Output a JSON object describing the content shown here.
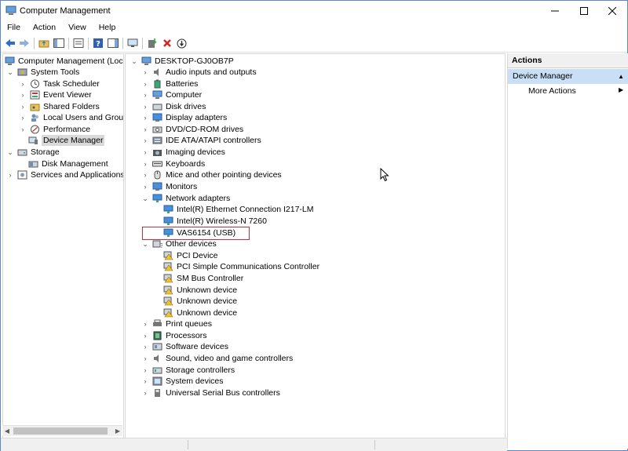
{
  "window": {
    "title": "Computer Management"
  },
  "menu": [
    "File",
    "Action",
    "View",
    "Help"
  ],
  "left_tree": [
    {
      "label": "Computer Management (Local",
      "indent": 0,
      "chev": "",
      "icon": "computer-management-icon"
    },
    {
      "label": "System Tools",
      "indent": 1,
      "chev": "down",
      "icon": "system-tools-icon"
    },
    {
      "label": "Task Scheduler",
      "indent": 2,
      "chev": "right",
      "icon": "task-scheduler-icon"
    },
    {
      "label": "Event Viewer",
      "indent": 2,
      "chev": "right",
      "icon": "event-viewer-icon"
    },
    {
      "label": "Shared Folders",
      "indent": 2,
      "chev": "right",
      "icon": "shared-folders-icon"
    },
    {
      "label": "Local Users and Groups",
      "indent": 2,
      "chev": "right",
      "icon": "users-icon"
    },
    {
      "label": "Performance",
      "indent": 2,
      "chev": "right",
      "icon": "performance-icon"
    },
    {
      "label": "Device Manager",
      "indent": 2,
      "chev": "",
      "icon": "device-manager-icon",
      "selected": true
    },
    {
      "label": "Storage",
      "indent": 1,
      "chev": "down",
      "icon": "storage-icon"
    },
    {
      "label": "Disk Management",
      "indent": 2,
      "chev": "",
      "icon": "disk-management-icon"
    },
    {
      "label": "Services and Applications",
      "indent": 1,
      "chev": "right",
      "icon": "services-icon"
    }
  ],
  "device_tree": {
    "root": "DESKTOP-GJ0OB7P",
    "categories": [
      {
        "label": "Audio inputs and outputs",
        "expanded": false,
        "icon": "audio-icon"
      },
      {
        "label": "Batteries",
        "expanded": false,
        "icon": "battery-icon"
      },
      {
        "label": "Computer",
        "expanded": false,
        "icon": "computer-icon"
      },
      {
        "label": "Disk drives",
        "expanded": false,
        "icon": "disk-drive-icon"
      },
      {
        "label": "Display adapters",
        "expanded": false,
        "icon": "display-icon"
      },
      {
        "label": "DVD/CD-ROM drives",
        "expanded": false,
        "icon": "dvd-icon"
      },
      {
        "label": "IDE ATA/ATAPI controllers",
        "expanded": false,
        "icon": "ide-icon"
      },
      {
        "label": "Imaging devices",
        "expanded": false,
        "icon": "camera-icon"
      },
      {
        "label": "Keyboards",
        "expanded": false,
        "icon": "keyboard-icon"
      },
      {
        "label": "Mice and other pointing devices",
        "expanded": false,
        "icon": "mouse-icon"
      },
      {
        "label": "Monitors",
        "expanded": false,
        "icon": "monitor-icon"
      },
      {
        "label": "Network adapters",
        "expanded": true,
        "icon": "network-icon",
        "children": [
          {
            "label": "Intel(R) Ethernet Connection I217-LM",
            "icon": "network-adapter-icon"
          },
          {
            "label": "Intel(R) Wireless-N 7260",
            "icon": "network-adapter-icon"
          },
          {
            "label": "VAS6154 (USB)",
            "icon": "network-adapter-icon",
            "highlighted": true
          }
        ]
      },
      {
        "label": "Other devices",
        "expanded": true,
        "icon": "other-devices-icon",
        "children": [
          {
            "label": "PCI Device",
            "icon": "warning-device-icon"
          },
          {
            "label": "PCI Simple Communications Controller",
            "icon": "warning-device-icon"
          },
          {
            "label": "SM Bus Controller",
            "icon": "warning-device-icon"
          },
          {
            "label": "Unknown device",
            "icon": "warning-device-icon"
          },
          {
            "label": "Unknown device",
            "icon": "warning-device-icon"
          },
          {
            "label": "Unknown device",
            "icon": "warning-device-icon"
          }
        ]
      },
      {
        "label": "Print queues",
        "expanded": false,
        "icon": "printer-icon"
      },
      {
        "label": "Processors",
        "expanded": false,
        "icon": "processor-icon"
      },
      {
        "label": "Software devices",
        "expanded": false,
        "icon": "software-icon"
      },
      {
        "label": "Sound, video and game controllers",
        "expanded": false,
        "icon": "sound-icon"
      },
      {
        "label": "Storage controllers",
        "expanded": false,
        "icon": "storage-controller-icon"
      },
      {
        "label": "System devices",
        "expanded": false,
        "icon": "system-devices-icon"
      },
      {
        "label": "Universal Serial Bus controllers",
        "expanded": false,
        "icon": "usb-icon"
      }
    ]
  },
  "actions": {
    "header": "Actions",
    "section": "Device Manager",
    "more": "More Actions"
  },
  "colors": {
    "accent_blue": "#2b6fc7",
    "selection_gray": "#d9d9d9",
    "actions_section_bg": "#c8dff5",
    "highlight_red": "#e0262a",
    "warning_yellow": "#f2c12e"
  }
}
